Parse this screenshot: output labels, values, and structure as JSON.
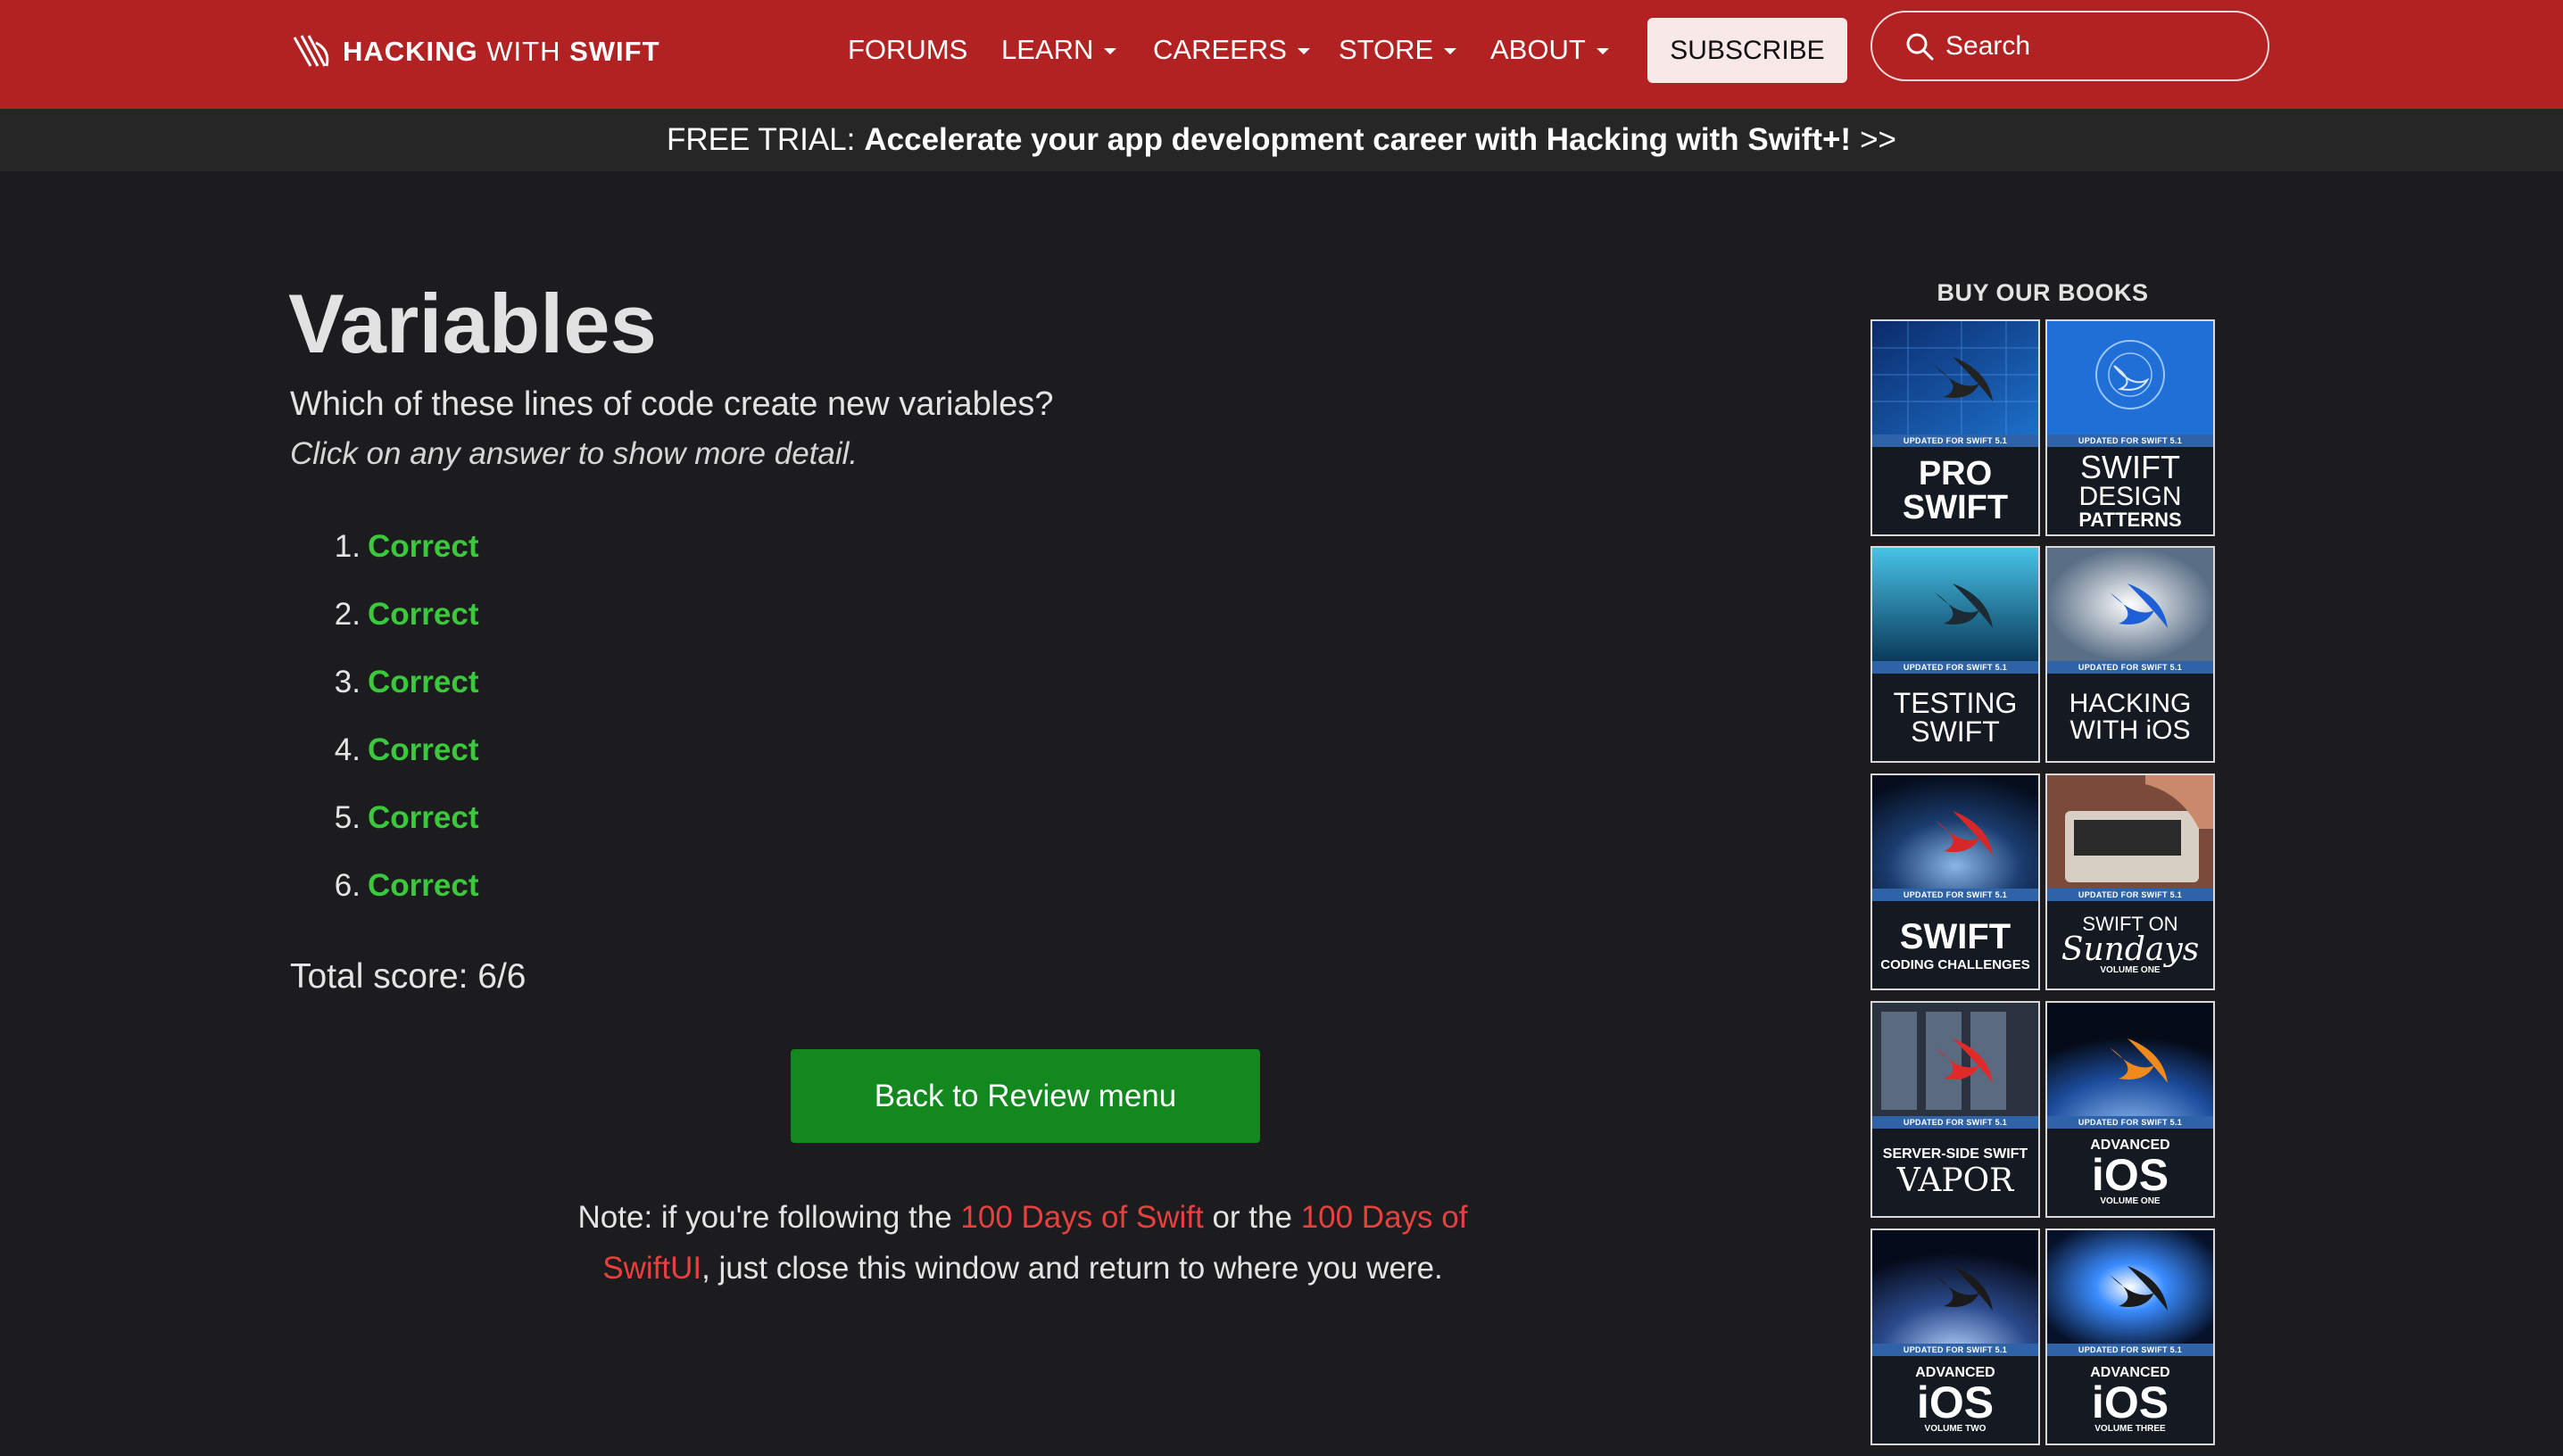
{
  "brand": {
    "name_bold": "HACKING",
    "name_mid": "WITH",
    "name_end": "SWIFT"
  },
  "nav": {
    "forums": "FORUMS",
    "learn": "LEARN",
    "careers": "CAREERS",
    "store": "STORE",
    "about": "ABOUT",
    "subscribe": "SUBSCRIBE",
    "search_placeholder": "Search"
  },
  "promo": {
    "prefix": "FREE TRIAL:",
    "message": "Accelerate your app development career with Hacking with Swift+!",
    "suffix": ">>"
  },
  "review": {
    "title": "Variables",
    "question": "Which of these lines of code create new variables?",
    "hint": "Click on any answer to show more detail.",
    "answers": [
      {
        "num": "1.",
        "result": "Correct"
      },
      {
        "num": "2.",
        "result": "Correct"
      },
      {
        "num": "3.",
        "result": "Correct"
      },
      {
        "num": "4.",
        "result": "Correct"
      },
      {
        "num": "5.",
        "result": "Correct"
      },
      {
        "num": "6.",
        "result": "Correct"
      }
    ],
    "score": "Total score: 6/6",
    "back_button": "Back to Review menu",
    "note": {
      "part1": "Note: if you're following the ",
      "link1": "100 Days of Swift",
      "part2": " or the ",
      "link2": "100 Days of SwiftUI",
      "part3": ", just close this window and return to where you were."
    }
  },
  "sidebar": {
    "heading": "BUY OUR BOOKS",
    "band_text": "UPDATED FOR SWIFT 5.1",
    "books": [
      {
        "line1": "PRO",
        "line2": "SWIFT",
        "line3": ""
      },
      {
        "line1": "SWIFT",
        "line2": "DESIGN",
        "line3": "PATTERNS"
      },
      {
        "line1": "TESTING",
        "line2": "SWIFT",
        "line3": ""
      },
      {
        "line1": "HACKING",
        "line2": "WITH iOS",
        "line3": ""
      },
      {
        "line1": "SWIFT",
        "line2": "CODING CHALLENGES",
        "line3": ""
      },
      {
        "line1": "SWIFT ON",
        "line2": "Sundays",
        "line3": "VOLUME ONE"
      },
      {
        "line1": "SERVER-SIDE SWIFT",
        "line2": "VAPOR",
        "line3": ""
      },
      {
        "line1": "ADVANCED",
        "line2": "iOS",
        "line3": "VOLUME ONE"
      },
      {
        "line1": "ADVANCED",
        "line2": "iOS",
        "line3": "VOLUME TWO"
      },
      {
        "line1": "ADVANCED",
        "line2": "iOS",
        "line3": "VOLUME THREE"
      }
    ]
  },
  "colors": {
    "navbar": "#b22222",
    "correct": "#3cc83c",
    "button_green": "#12881f",
    "link_red": "#e8413d",
    "background": "#1c1c1e"
  }
}
